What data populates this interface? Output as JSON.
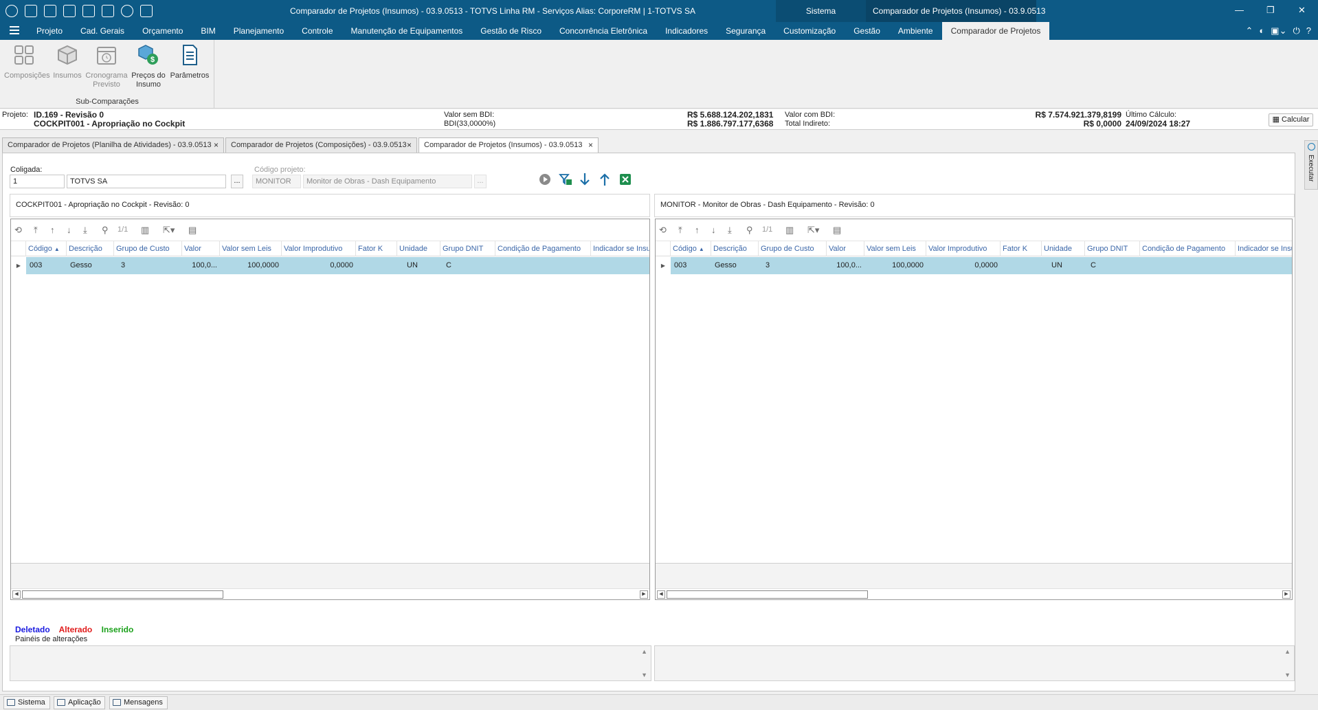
{
  "titlebar": {
    "title": "Comparador de Projetos (Insumos) - 03.9.0513 - TOTVS Linha RM - Serviços  Alias: CorporeRM | 1-TOTVS SA",
    "sistema_tab": "Sistema",
    "context_tab": "Comparador de Projetos (Insumos) - 03.9.0513",
    "icons": [
      "refresh-icon",
      "user-gear-icon",
      "calendar-icon",
      "calendar-gear-icon",
      "home-icon",
      "grid-icon",
      "globe-icon",
      "external-icon"
    ]
  },
  "menu": {
    "items": [
      "Projeto",
      "Cad. Gerais",
      "Orçamento",
      "BIM",
      "Planejamento",
      "Controle",
      "Manutenção de Equipamentos",
      "Gestão de Risco",
      "Concorrência Eletrônica",
      "Indicadores",
      "Segurança",
      "Customização",
      "Gestão",
      "Ambiente",
      "Comparador de Projetos"
    ],
    "active_index": 14
  },
  "ribbon": {
    "buttons": [
      {
        "label": "Composições",
        "icon": "compositions-icon"
      },
      {
        "label": "Insumos",
        "icon": "box-icon"
      },
      {
        "label": "Cronograma Previsto",
        "icon": "schedule-icon"
      },
      {
        "label": "Preços do Insumo",
        "icon": "price-icon"
      },
      {
        "label": "Parâmetros",
        "icon": "document-icon"
      }
    ],
    "group_label": "Sub-Comparações"
  },
  "info": {
    "projeto_label": "Projeto:",
    "projeto_id": "ID.169 - Revisão 0",
    "projeto_name": "COCKPIT001 - Apropriação no Cockpit",
    "valor_sem_bdi_label": "Valor sem BDI:",
    "bdi_label": "BDI(33,0000%)",
    "valor_sem_bdi": "R$ 5.688.124.202,1831",
    "bdi_value": "R$ 1.886.797.177,6368",
    "valor_com_bdi_label": "Valor com BDI:",
    "total_indireto_label": "Total Indireto:",
    "valor_com_bdi": "R$ 7.574.921.379,8199",
    "total_indireto": "R$ 0,0000",
    "ultimo_calculo_label": "Último Cálculo:",
    "ultimo_calculo": "24/09/2024 18:27",
    "calc_button": "Calcular"
  },
  "doctabs": [
    "Comparador de Projetos (Planilha de Atividades) - 03.9.0513",
    "Comparador de Projetos (Composições) - 03.9.0513",
    "Comparador de Projetos (Insumos) - 03.9.0513"
  ],
  "side_panel": "Executar",
  "form": {
    "coligada_label": "Coligada:",
    "coligada_code": "1",
    "coligada_name": "TOTVS SA",
    "codigo_label": "Código projeto:",
    "codigo_value": "MONITOR",
    "codigo_name": "Monitor de Obras - Dash Equipamento",
    "ellipsis": "..."
  },
  "grid_columns": [
    "Código",
    "Descrição",
    "Grupo de Custo",
    "Valor",
    "Valor sem Leis",
    "Valor Improdutivo",
    "Fator K",
    "Unidade",
    "Grupo DNIT",
    "Condição de Pagamento",
    "Indicador se Insumo"
  ],
  "grid_page": "1/1",
  "left": {
    "title": "COCKPIT001 - Apropriação no Cockpit - Revisão: 0",
    "row": {
      "codigo": "003",
      "descricao": "Gesso",
      "grupo": "3",
      "valor": "100,0...",
      "valor_sem_leis": "100,0000",
      "valor_improdutivo": "0,0000",
      "fator_k": "",
      "unidade": "UN",
      "grupo_dnit": "C",
      "condicao": "",
      "indicador": ""
    }
  },
  "right": {
    "title": "MONITOR - Monitor de Obras - Dash Equipamento - Revisão: 0",
    "row": {
      "codigo": "003",
      "descricao": "Gesso",
      "grupo": "3",
      "valor": "100,0...",
      "valor_sem_leis": "100,0000",
      "valor_improdutivo": "0,0000",
      "fator_k": "",
      "unidade": "UN",
      "grupo_dnit": "C",
      "condicao": "",
      "indicador": ""
    }
  },
  "legend": {
    "deletado": "Deletado",
    "alterado": "Alterado",
    "inserido": "Inserido",
    "colors": {
      "deletado": "#1a1ae0",
      "alterado": "#e01a1a",
      "inserido": "#1aa01a"
    }
  },
  "changes_label": "Painéis de alterações",
  "statusbar": [
    "Sistema",
    "Aplicação",
    "Mensagens"
  ],
  "colors": {
    "titlebar": "#0d5a86",
    "selected_row": "#b0d8e6"
  }
}
